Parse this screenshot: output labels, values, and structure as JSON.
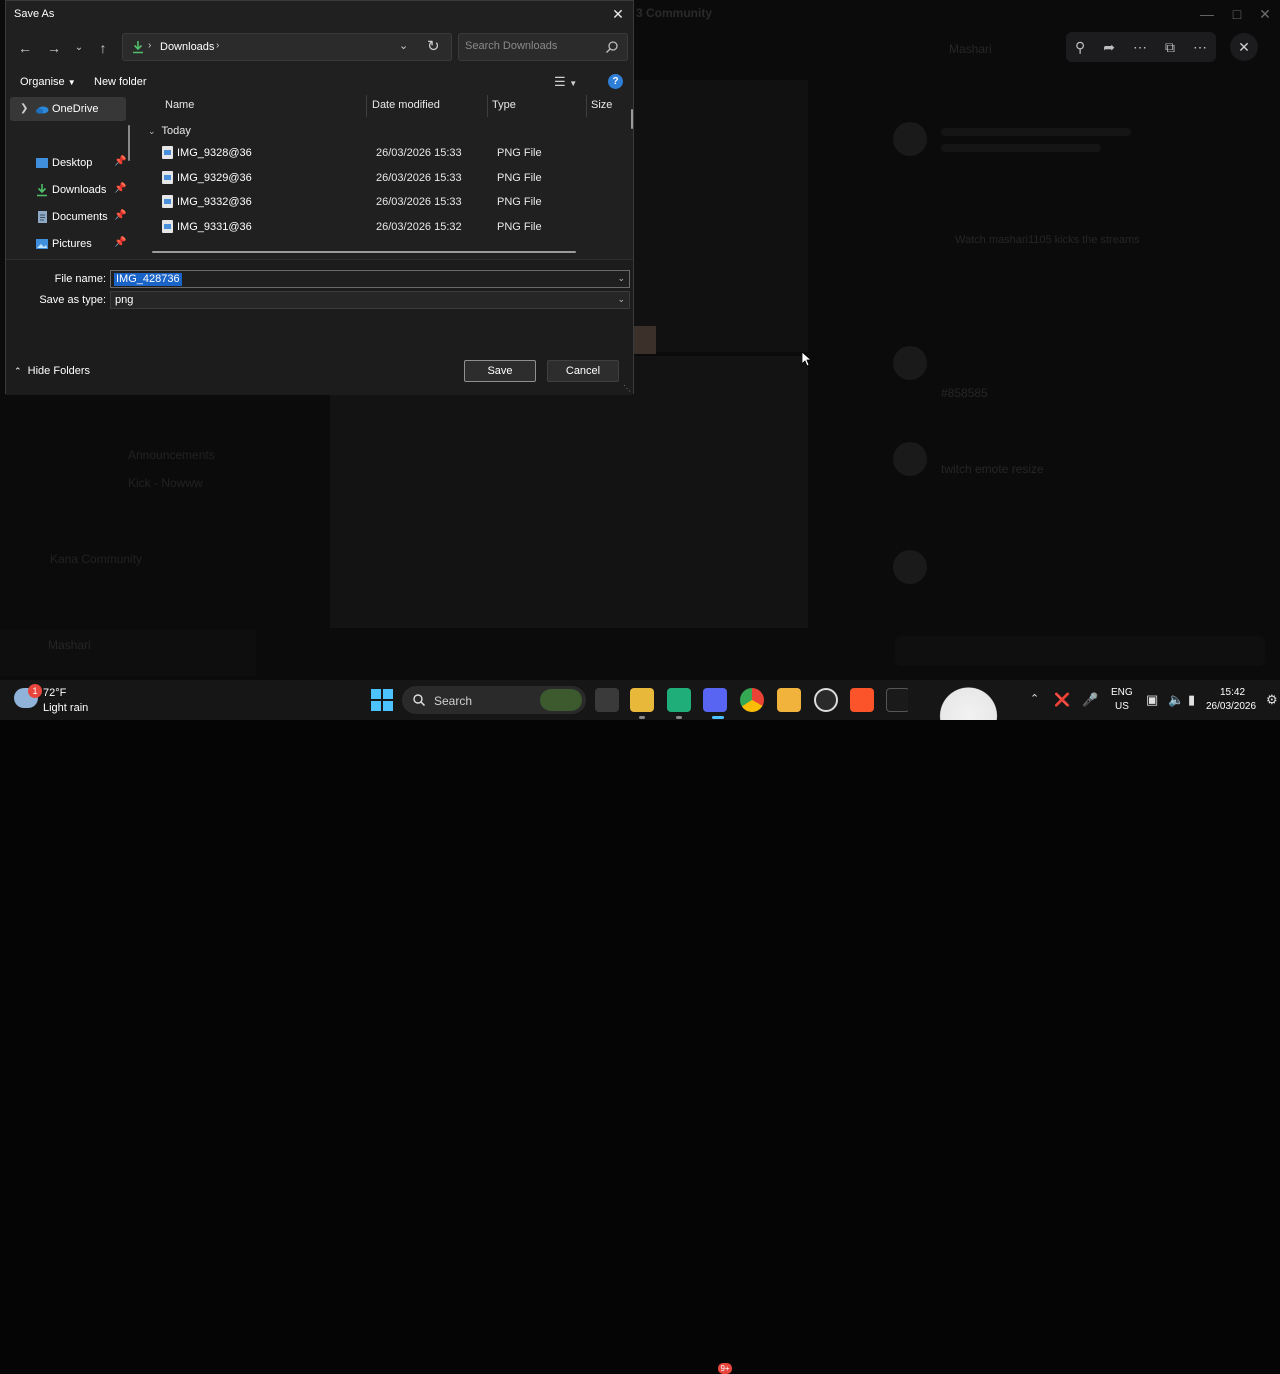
{
  "background": {
    "title": "3 Community",
    "chat_ghost": [
      "Mashari",
      "Watch mashari1105 kicks the streams",
      "#858585",
      "twitch emote resize"
    ],
    "channels_ghost": [
      "Announcements",
      "Kick - Nowww",
      "Kana Community"
    ],
    "user_ghost": "Mashari"
  },
  "dialog": {
    "title": "Save As",
    "address": {
      "folder": "Downloads"
    },
    "search_placeholder": "Search Downloads",
    "toolbar": {
      "organise": "Organise",
      "new_folder": "New folder"
    },
    "nav_pane": [
      {
        "label": "OneDrive",
        "icon": "onedrive-icon",
        "selected": true
      },
      {
        "label": "Desktop",
        "icon": "desktop-icon",
        "pinned": true
      },
      {
        "label": "Downloads",
        "icon": "downloads-icon",
        "pinned": true
      },
      {
        "label": "Documents",
        "icon": "documents-icon",
        "pinned": true
      },
      {
        "label": "Pictures",
        "icon": "pictures-icon",
        "pinned": true
      }
    ],
    "columns": [
      "Name",
      "Date modified",
      "Type",
      "Size"
    ],
    "group": "Today",
    "files": [
      {
        "name": "IMG_9328@36",
        "date": "26/03/2026 15:33",
        "type": "PNG File"
      },
      {
        "name": "IMG_9329@36",
        "date": "26/03/2026 15:33",
        "type": "PNG File"
      },
      {
        "name": "IMG_9332@36",
        "date": "26/03/2026 15:33",
        "type": "PNG File"
      },
      {
        "name": "IMG_9331@36",
        "date": "26/03/2026 15:32",
        "type": "PNG File"
      }
    ],
    "file_name_label": "File name:",
    "file_name_value": "IMG_428736",
    "save_as_type_label": "Save as type:",
    "save_as_type_value": "png",
    "hide_folders": "Hide Folders",
    "save_label": "Save",
    "cancel_label": "Cancel"
  },
  "taskbar": {
    "weather": {
      "temp": "72°F",
      "desc": "Light rain",
      "badge": "1"
    },
    "search_label": "Search",
    "discord_badge": "9+",
    "lang_line1": "ENG",
    "lang_line2": "US",
    "time": "15:42",
    "date": "26/03/2026"
  },
  "colors": {
    "accent": "#2f7fd8",
    "selection": "#1a63c7",
    "dialog_bg": "#202020"
  }
}
